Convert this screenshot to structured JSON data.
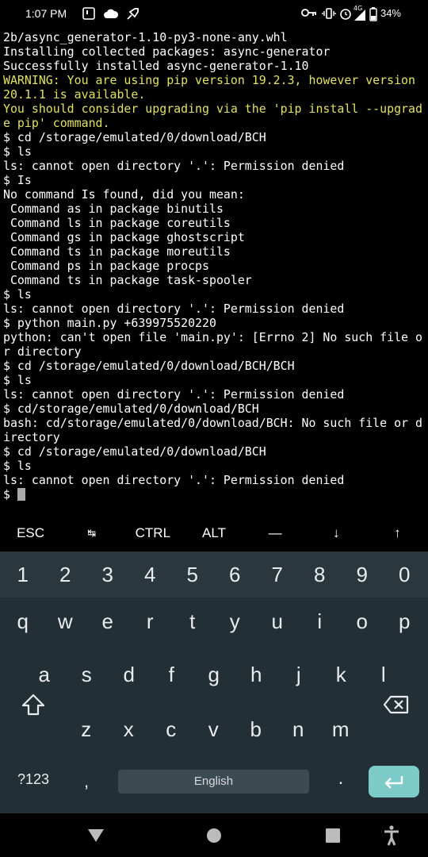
{
  "status_bar": {
    "time": "1:07 PM",
    "battery": "34%",
    "network": "4G"
  },
  "terminal": {
    "lines": [
      "2b/async_generator-1.10-py3-none-any.whl",
      "Installing collected packages: async-generator",
      "Successfully installed async-generator-1.10",
      "WARNING: You are using pip version 19.2.3, however version",
      "20.1.1 is available.",
      "You should consider upgrading via the 'pip install --upgrad",
      "e pip' command.",
      "$ cd /storage/emulated/0/download/BCH",
      "$ ls",
      "ls: cannot open directory '.': Permission denied",
      "$ Is",
      "No command Is found, did you mean:",
      " Command as in package binutils",
      " Command ls in package coreutils",
      " Command gs in package ghostscript",
      " Command ts in package moreutils",
      " Command ps in package procps",
      " Command ts in package task-spooler",
      "$ ls",
      "ls: cannot open directory '.': Permission denied",
      "$ python main.py +639975520220",
      "python: can't open file 'main.py': [Errno 2] No such file o",
      "r directory",
      "$ cd /storage/emulated/0/download/BCH/BCH",
      "$ ls",
      "ls: cannot open directory '.': Permission denied",
      "$ cd/storage/emulated/0/download/BCH",
      "bash: cd/storage/emulated/0/download/BCH: No such file or d",
      "irectory",
      "$ cd /storage/emulated/0/download/BCH",
      "$ ls",
      "ls: cannot open directory '.': Permission denied"
    ],
    "prompt": "$ ",
    "warning_color": "#e3e359"
  },
  "extra_keys": [
    "ESC",
    "↹",
    "CTRL",
    "ALT",
    "—",
    "↓",
    "↑"
  ],
  "keyboard": {
    "numbers": [
      "1",
      "2",
      "3",
      "4",
      "5",
      "6",
      "7",
      "8",
      "9",
      "0"
    ],
    "row1": [
      "q",
      "w",
      "e",
      "r",
      "t",
      "y",
      "u",
      "i",
      "o",
      "p"
    ],
    "row2": [
      "a",
      "s",
      "d",
      "f",
      "g",
      "h",
      "j",
      "k",
      "l"
    ],
    "row3": [
      "z",
      "x",
      "c",
      "v",
      "b",
      "n",
      "m"
    ],
    "symbols_label": "?123",
    "comma": ",",
    "period": ".",
    "space_label": "English",
    "accent_color": "#7ccbc8"
  }
}
